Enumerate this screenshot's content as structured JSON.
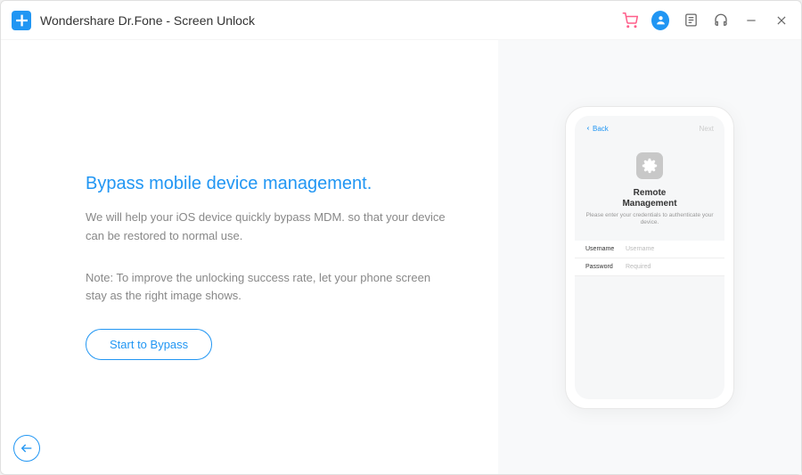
{
  "app": {
    "title": "Wondershare Dr.Fone - Screen Unlock"
  },
  "main": {
    "heading": "Bypass mobile device management.",
    "description": "We will help your iOS device quickly bypass MDM. so that your device can be restored to normal use.",
    "note": "Note: To improve the unlocking success rate, let your phone screen stay as the right image shows.",
    "button_label": "Start to Bypass"
  },
  "phone": {
    "back_label": "Back",
    "next_label": "Next",
    "title": "Remote Management",
    "subtitle": "Please enter your credentials to authenticate your device.",
    "username_label": "Username",
    "username_placeholder": "Username",
    "password_label": "Password",
    "password_placeholder": "Required"
  }
}
